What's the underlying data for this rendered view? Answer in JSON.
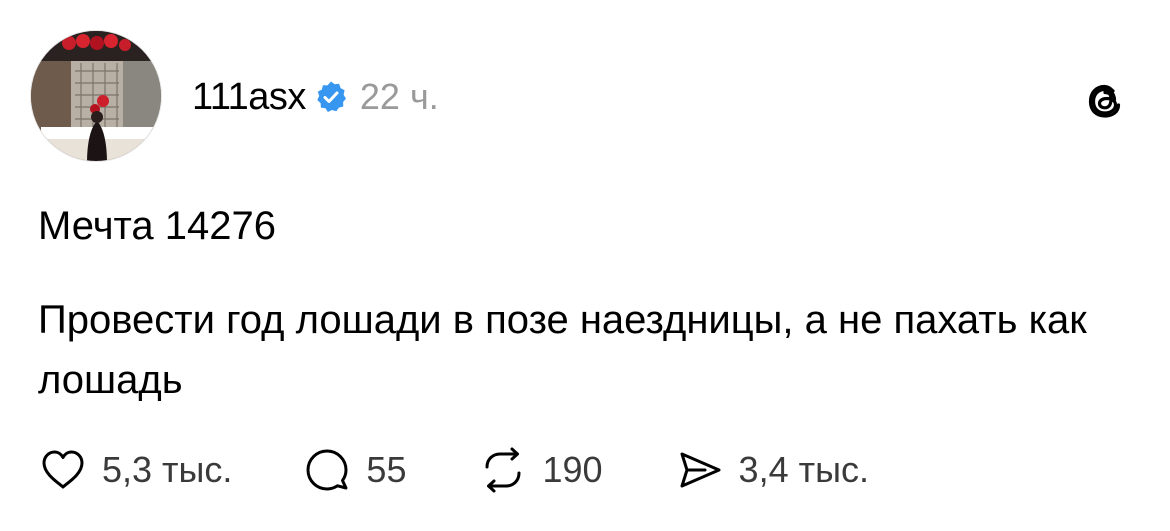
{
  "post": {
    "author": {
      "username": "111asx",
      "verified": true,
      "verified_color": "#3797f0",
      "avatar_icon": "avatar-photo"
    },
    "time": "22 ч.",
    "app_icon": "threads-logo-icon",
    "title": "Мечта 14276",
    "body": "Провести год лошади в позе наездницы, а не пахать как лошадь",
    "actions": {
      "likes": {
        "icon": "heart-icon",
        "count": "5,3 тыс."
      },
      "replies": {
        "icon": "comment-icon",
        "count": "55"
      },
      "reposts": {
        "icon": "repost-icon",
        "count": "190"
      },
      "shares": {
        "icon": "send-icon",
        "count": "3,4 тыс."
      }
    }
  }
}
